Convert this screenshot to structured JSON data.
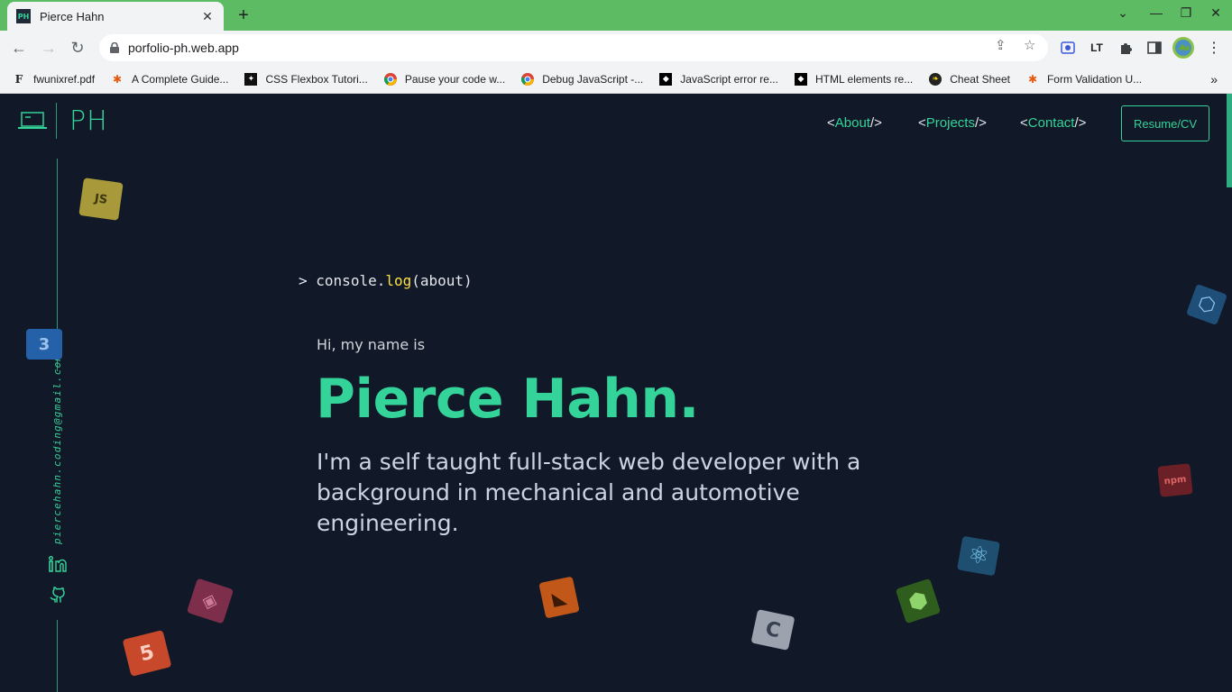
{
  "browser": {
    "tab_title": "Pierce Hahn",
    "favicon_text": "PH",
    "url": "porfolio-ph.web.app",
    "bookmarks": [
      {
        "label": "fwunixref.pdf",
        "icon": "f-icon"
      },
      {
        "label": "A Complete Guide...",
        "icon": "asterisk-icon"
      },
      {
        "label": "CSS Flexbox Tutori...",
        "icon": "css-tricks-icon"
      },
      {
        "label": "Pause your code w...",
        "icon": "chrome-icon"
      },
      {
        "label": "Debug JavaScript -...",
        "icon": "chrome-icon"
      },
      {
        "label": "JavaScript error re...",
        "icon": "mdn-icon"
      },
      {
        "label": "HTML elements re...",
        "icon": "mdn-icon"
      },
      {
        "label": "Cheat Sheet",
        "icon": "leaf-icon"
      },
      {
        "label": "Form Validation U...",
        "icon": "asterisk-icon"
      }
    ]
  },
  "site": {
    "logo": "PH",
    "nav": [
      {
        "open": "<",
        "label": "About",
        "close": "/>"
      },
      {
        "open": "<",
        "label": "Projects",
        "close": "/>"
      },
      {
        "open": "<",
        "label": "Contact",
        "close": "/>"
      }
    ],
    "resume_label": "Resume/CV",
    "email": "piercehahn.coding@gmail.com"
  },
  "hero": {
    "console_prompt": ">",
    "console_obj": "console.",
    "console_fn": "log",
    "console_args": "(about)",
    "intro": "Hi, my name is",
    "name": "Pierce Hahn.",
    "tagline": "I'm a self taught full-stack web developer with a background in mechanical and automotive engineering."
  },
  "decor_cubes": [
    {
      "name": "js-cube",
      "label": "JS",
      "color": "#a89a3a"
    },
    {
      "name": "css3-cube",
      "label": "3",
      "color": "#2561a8"
    },
    {
      "name": "webpack-cube",
      "label": "⬡",
      "color": "#1f4e79"
    },
    {
      "name": "npm-cube",
      "label": "npm",
      "color": "#6b1f26"
    },
    {
      "name": "react-cube",
      "label": "⚛",
      "color": "#1e4f70"
    },
    {
      "name": "node-cube",
      "label": "⬢",
      "color": "#2f5d1e"
    },
    {
      "name": "c-cube",
      "label": "C",
      "color": "#9ca3af"
    },
    {
      "name": "swift-cube",
      "label": "◣",
      "color": "#c2571a"
    },
    {
      "name": "sass-cube",
      "label": "◈",
      "color": "#7d2e4a"
    },
    {
      "name": "html5-cube",
      "label": "5",
      "color": "#c8482b"
    }
  ]
}
